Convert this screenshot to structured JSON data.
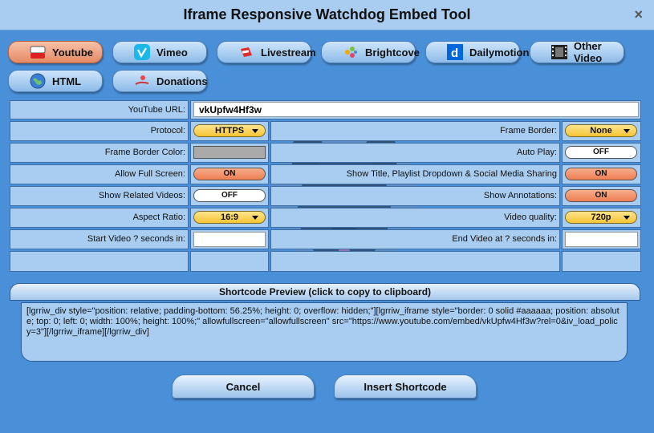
{
  "window": {
    "title": "Iframe Responsive Watchdog Embed Tool",
    "close_glyph": "×"
  },
  "tabs": [
    {
      "label": "Youtube",
      "icon": "youtube-icon",
      "active": true
    },
    {
      "label": "Vimeo",
      "icon": "vimeo-icon"
    },
    {
      "label": "Livestream",
      "icon": "livestream-icon"
    },
    {
      "label": "Brightcove",
      "icon": "brightcove-icon"
    },
    {
      "label": "Dailymotion",
      "icon": "dailymotion-icon"
    },
    {
      "label": "Other Video",
      "icon": "film-icon"
    },
    {
      "label": "HTML",
      "icon": "globe-icon"
    },
    {
      "label": "Donations",
      "icon": "donations-icon"
    }
  ],
  "form": {
    "youtube_url_label": "YouTube URL:",
    "youtube_url_value": "vkUpfw4Hf3w",
    "protocol_label": "Protocol:",
    "protocol_value": "HTTPS",
    "frame_border_label": "Frame Border:",
    "frame_border_value": "None",
    "frame_border_color_label": "Frame Border Color:",
    "frame_border_color": "#aaaaaa",
    "autoplay_label": "Auto Play:",
    "autoplay_value": "OFF",
    "allow_fullscreen_label": "Allow Full Screen:",
    "allow_fullscreen_value": "ON",
    "show_title_label": "Show Title, Playlist Dropdown & Social Media Sharing",
    "show_title_value": "ON",
    "show_related_label": "Show Related Videos:",
    "show_related_value": "OFF",
    "show_annotations_label": "Show Annotations:",
    "show_annotations_value": "ON",
    "aspect_ratio_label": "Aspect Ratio:",
    "aspect_ratio_value": "16:9",
    "video_quality_label": "Video quality:",
    "video_quality_value": "720p",
    "start_video_label": "Start Video ? seconds in:",
    "start_video_value": "",
    "end_video_label": "End Video at ? seconds in:",
    "end_video_value": ""
  },
  "preview": {
    "header": "Shortcode Preview (click to copy to clipboard)",
    "code": "[lgrriw_div style=\"position: relative; padding-bottom: 56.25%; height: 0; overflow: hidden;\"][lgrriw_iframe style=\"border: 0 solid #aaaaaa; position: absolute; top: 0; left: 0; width: 100%; height: 100%;\" allowfullscreen=\"allowfullscreen\" src=\"https://www.youtube.com/embed/vkUpfw4Hf3w?rel=0&iv_load_policy=3\"][/lgrriw_iframe][/lgrriw_div]"
  },
  "buttons": {
    "cancel": "Cancel",
    "insert": "Insert Shortcode"
  },
  "colors": {
    "background": "#4a90d9",
    "panel": "#a9cdf0",
    "active_tab": "#e48a63",
    "on_toggle": "#ee7d52",
    "select": "#f4c434"
  }
}
